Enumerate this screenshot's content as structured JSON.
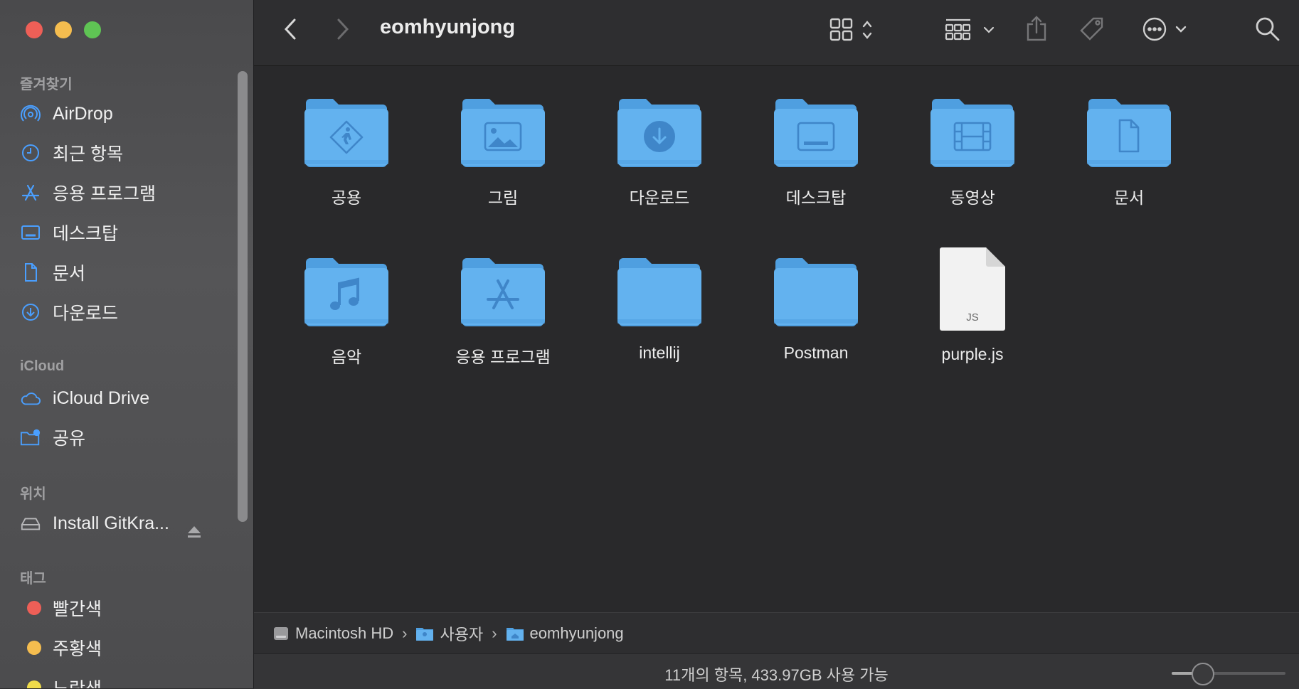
{
  "window": {
    "title": "eomhyunjong"
  },
  "sidebar": {
    "sections": [
      {
        "title": "즐겨찾기"
      },
      {
        "title": "iCloud"
      },
      {
        "title": "위치"
      },
      {
        "title": "태그"
      }
    ],
    "favorites": [
      {
        "label": "AirDrop",
        "icon": "airdrop-icon"
      },
      {
        "label": "최근 항목",
        "icon": "clock-icon"
      },
      {
        "label": "응용 프로그램",
        "icon": "applications-icon"
      },
      {
        "label": "데스크탑",
        "icon": "desktop-icon"
      },
      {
        "label": "문서",
        "icon": "document-icon"
      },
      {
        "label": "다운로드",
        "icon": "download-icon"
      }
    ],
    "icloud": [
      {
        "label": "iCloud Drive",
        "icon": "cloud-icon"
      },
      {
        "label": "공유",
        "icon": "shared-folder-icon"
      }
    ],
    "locations": [
      {
        "label": "Install GitKra...",
        "icon": "drive-icon"
      }
    ],
    "tags": [
      {
        "label": "빨간색",
        "color": "#ee5f57"
      },
      {
        "label": "주황색",
        "color": "#f5bd4f"
      },
      {
        "label": "노란색",
        "color": "#f0dc4b"
      }
    ]
  },
  "items": [
    {
      "label": "공용",
      "kind": "folder",
      "glyph": "public"
    },
    {
      "label": "그림",
      "kind": "folder",
      "glyph": "pictures"
    },
    {
      "label": "다운로드",
      "kind": "folder",
      "glyph": "downloads"
    },
    {
      "label": "데스크탑",
      "kind": "folder",
      "glyph": "desktop"
    },
    {
      "label": "동영상",
      "kind": "folder",
      "glyph": "movies"
    },
    {
      "label": "문서",
      "kind": "folder",
      "glyph": "documents"
    },
    {
      "label": "음악",
      "kind": "folder",
      "glyph": "music"
    },
    {
      "label": "응용 프로그램",
      "kind": "folder",
      "glyph": "applications"
    },
    {
      "label": "intellij",
      "kind": "folder",
      "glyph": ""
    },
    {
      "label": "Postman",
      "kind": "folder",
      "glyph": ""
    },
    {
      "label": "purple.js",
      "kind": "file",
      "glyph": "JS"
    }
  ],
  "pathbar": [
    {
      "label": "Macintosh HD",
      "icon": "hard-drive-icon"
    },
    {
      "label": "사용자",
      "icon": "users-folder-icon"
    },
    {
      "label": "eomhyunjong",
      "icon": "home-folder-icon"
    }
  ],
  "status": {
    "text": "11개의 항목, 433.97GB 사용 가능",
    "icon_size_level": 0.25
  },
  "colors": {
    "folder": "#63b2ef",
    "folder_tab": "#4f9fe0",
    "accent": "#3b8fe8"
  }
}
